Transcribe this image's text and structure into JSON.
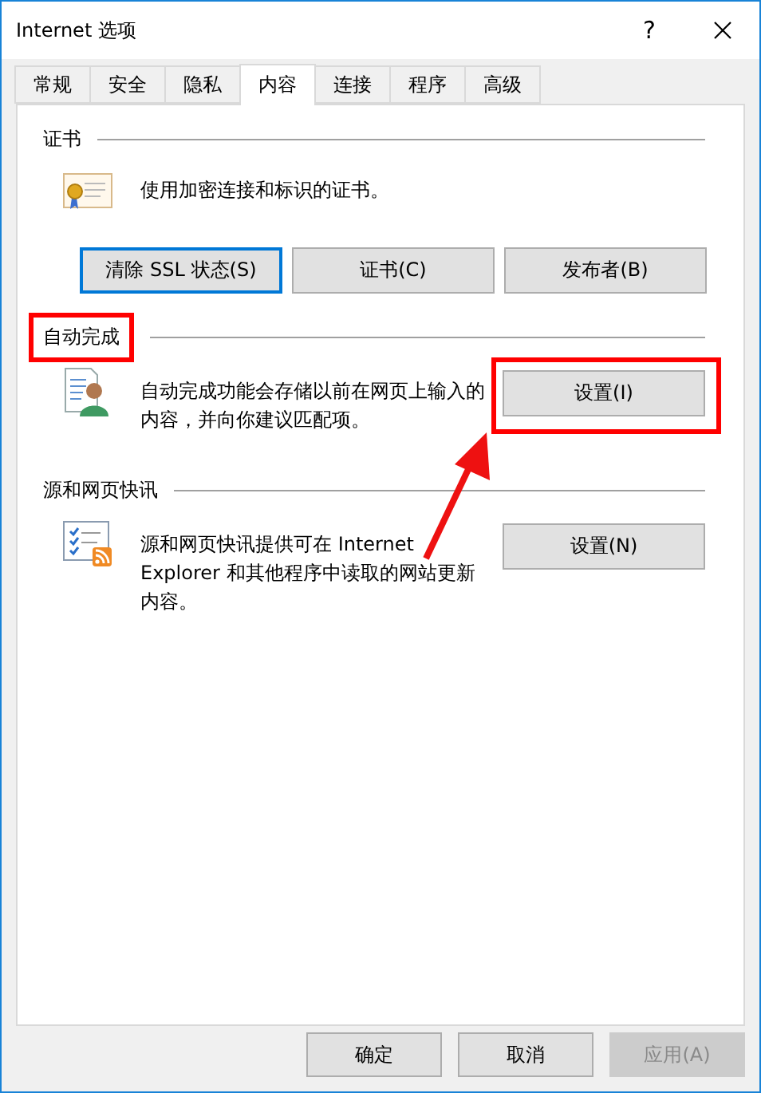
{
  "window": {
    "title": "Internet 选项",
    "help": "?"
  },
  "tabs": [
    {
      "label": "常规",
      "selected": false
    },
    {
      "label": "安全",
      "selected": false
    },
    {
      "label": "隐私",
      "selected": false
    },
    {
      "label": "内容",
      "selected": true
    },
    {
      "label": "连接",
      "selected": false
    },
    {
      "label": "程序",
      "selected": false
    },
    {
      "label": "高级",
      "selected": false
    }
  ],
  "sections": [
    {
      "title": "证书",
      "highlighted": false,
      "kind": "stacked",
      "text": "使用加密连接和标识的证书。",
      "buttons": [
        {
          "label": "清除 SSL 状态(S)",
          "focused": true,
          "highlighted": false
        },
        {
          "label": "证书(C)",
          "focused": false,
          "highlighted": false
        },
        {
          "label": "发布者(B)",
          "focused": false,
          "highlighted": false
        }
      ]
    },
    {
      "title": "自动完成",
      "highlighted": true,
      "kind": "side",
      "text": "自动完成功能会存储以前在网页上输入的内容，并向你建议匹配项。",
      "buttons": [
        {
          "label": "设置(I)",
          "focused": false,
          "highlighted": true
        }
      ]
    },
    {
      "title": "源和网页快讯",
      "highlighted": false,
      "kind": "side",
      "text": "源和网页快讯提供可在 Internet Explorer 和其他程序中读取的网站更新内容。",
      "buttons": [
        {
          "label": "设置(N)",
          "focused": false,
          "highlighted": false
        }
      ]
    }
  ],
  "footer_buttons": [
    {
      "label": "确定",
      "disabled": false
    },
    {
      "label": "取消",
      "disabled": false
    },
    {
      "label": "应用(A)",
      "disabled": true
    }
  ]
}
